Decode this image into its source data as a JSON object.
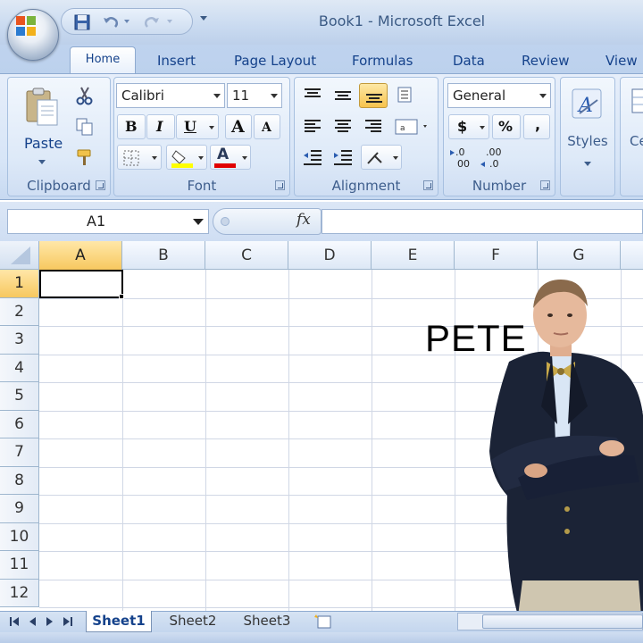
{
  "window": {
    "title": "Book1 - Microsoft Excel"
  },
  "tabs": [
    {
      "label": "Home"
    },
    {
      "label": "Insert"
    },
    {
      "label": "Page Layout"
    },
    {
      "label": "Formulas"
    },
    {
      "label": "Data"
    },
    {
      "label": "Review"
    },
    {
      "label": "View"
    }
  ],
  "ribbon": {
    "clipboard": {
      "label": "Clipboard",
      "paste_label": "Paste"
    },
    "font": {
      "label": "Font",
      "font_name": "Calibri",
      "font_size": "11",
      "bold": "B",
      "italic": "I",
      "underline": "U",
      "grow": "A",
      "shrink": "A",
      "font_color_letter": "A"
    },
    "alignment": {
      "label": "Alignment"
    },
    "number": {
      "label": "Number",
      "format": "General",
      "currency": "$",
      "percent": "%",
      "comma": ","
    },
    "styles": {
      "label": "Styles"
    },
    "cells": {
      "label": "Ce"
    }
  },
  "formula_bar": {
    "name_box": "A1",
    "fx": "fx",
    "formula": ""
  },
  "grid": {
    "columns": [
      "A",
      "B",
      "C",
      "D",
      "E",
      "F",
      "G"
    ],
    "rows": [
      "1",
      "2",
      "3",
      "4",
      "5",
      "6",
      "7",
      "8",
      "9",
      "10",
      "11",
      "12"
    ],
    "active_cell": "A1"
  },
  "overlay_text": "PETE",
  "sheets": [
    {
      "label": "Sheet1",
      "active": true
    },
    {
      "label": "Sheet2",
      "active": false
    },
    {
      "label": "Sheet3",
      "active": false
    }
  ],
  "colors": {
    "accent": "#15428b",
    "active_header": "#f7c85f",
    "ribbon": "#d7e5f7"
  }
}
